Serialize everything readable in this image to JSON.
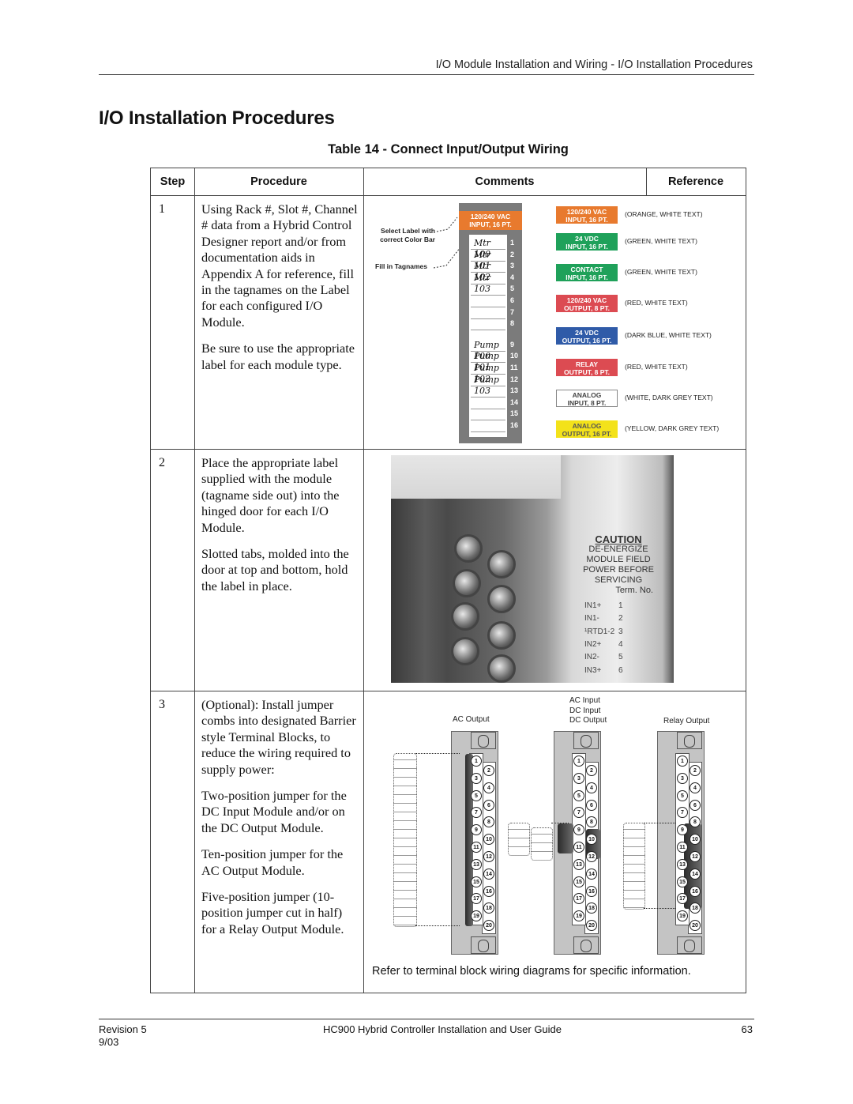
{
  "header": {
    "running_head": "I/O Module Installation and Wiring - I/O Installation Procedures"
  },
  "page_title": "I/O Installation Procedures",
  "table": {
    "caption": "Table 14 - Connect Input/Output Wiring",
    "columns": [
      "Step",
      "Procedure",
      "Comments",
      "Reference"
    ],
    "rows": [
      {
        "step": "1",
        "procedure": [
          "Using Rack #, Slot #, Channel # data from a Hybrid Control Designer report and/or from documentation aids in Appendix A for reference, fill in the tagnames on the Label for each configured I/O Module.",
          "Be sure to use the appropriate label for each module type."
        ],
        "figure": {
          "callouts": [
            "Select Label with correct Color Bar",
            "Fill in Tagnames"
          ],
          "sample_label": {
            "bar_text": [
              "120/240  VAC",
              "INPUT, 16 PT."
            ],
            "bar_color": "#e87a2e",
            "tagnames": [
              "Mtr 100",
              "Mtr 101",
              "Mtr 102",
              "Mtr 103",
              "",
              "",
              "",
              "",
              "Pump 100",
              "Pump 101",
              "Pump 102",
              "Pump 103",
              "",
              "",
              "",
              ""
            ],
            "channels": [
              "1",
              "2",
              "3",
              "4",
              "5",
              "6",
              "7",
              "8",
              "9",
              "10",
              "11",
              "12",
              "13",
              "14",
              "15",
              "16"
            ]
          },
          "label_types": [
            {
              "line1": "120/240  VAC",
              "line2": "INPUT, 16 PT.",
              "desc": "(ORANGE, WHITE TEXT)",
              "bg": "#e87a2e",
              "fg": "#ffffff"
            },
            {
              "line1": "24   VDC",
              "line2": "INPUT, 16 PT.",
              "desc": "(GREEN, WHITE TEXT)",
              "bg": "#1fa15a",
              "fg": "#ffffff"
            },
            {
              "line1": "CONTACT",
              "line2": "INPUT, 16 PT.",
              "desc": "(GREEN, WHITE TEXT)",
              "bg": "#1fa15a",
              "fg": "#ffffff"
            },
            {
              "line1": "120/240  VAC",
              "line2": "OUTPUT, 8 PT.",
              "desc": "(RED, WHITE TEXT)",
              "bg": "#dc4b52",
              "fg": "#ffffff"
            },
            {
              "line1": "24  VDC",
              "line2": "OUTPUT, 16 PT.",
              "desc": "(DARK BLUE, WHITE TEXT)",
              "bg": "#2f5ba8",
              "fg": "#ffffff"
            },
            {
              "line1": "RELAY",
              "line2": "OUTPUT, 8 PT.",
              "desc": "(RED, WHITE TEXT)",
              "bg": "#dc4b52",
              "fg": "#ffffff"
            },
            {
              "line1": "ANALOG",
              "line2": "INPUT, 8 PT.",
              "desc": "(WHITE, DARK GREY TEXT)",
              "bg": "#ffffff",
              "fg": "#444444"
            },
            {
              "line1": "ANALOG",
              "line2": "OUTPUT, 16 PT.",
              "desc": "(YELLOW, DARK GREY TEXT)",
              "bg": "#f3e21a",
              "fg": "#555555"
            }
          ]
        }
      },
      {
        "step": "2",
        "procedure": [
          "Place the appropriate label supplied with the module (tagname side out) into the hinged door for each I/O Module.",
          "Slotted tabs, molded into the door at top and bottom, hold the label in place."
        ],
        "photo": {
          "caution_title": "CAUTION",
          "caution_lines": [
            "DE-ENERGIZE",
            "MODULE FIELD",
            "POWER BEFORE",
            "SERVICING"
          ],
          "term_header": "Term. No.",
          "terms": [
            {
              "name": "IN1+",
              "no": "1"
            },
            {
              "name": "IN1-",
              "no": "2"
            },
            {
              "name": "¹RTD1-2",
              "no": "3"
            },
            {
              "name": "IN2+",
              "no": "4"
            },
            {
              "name": "IN2-",
              "no": "5"
            },
            {
              "name": "IN3+",
              "no": "6"
            }
          ]
        }
      },
      {
        "step": "3",
        "procedure": [
          "(Optional): Install jumper combs into designated Barrier style Terminal Blocks, to reduce the wiring required to supply power:",
          "Two-position jumper for the DC Input Module and/or on the DC Output Module.",
          "Ten-position jumper for the AC Output Module.",
          "Five-position jumper (10-position jumper cut in half) for a Relay Output Module."
        ],
        "diagram": {
          "modules": [
            {
              "label": [
                "AC Output"
              ]
            },
            {
              "label": [
                "AC Input",
                "DC Input",
                "DC Output"
              ]
            },
            {
              "label": [
                "Relay Output"
              ]
            }
          ],
          "terminals_odd": [
            "1",
            "3",
            "5",
            "7",
            "9",
            "11",
            "13",
            "15",
            "17",
            "19"
          ],
          "terminals_even": [
            "2",
            "4",
            "6",
            "8",
            "10",
            "12",
            "14",
            "16",
            "18",
            "20"
          ],
          "note": "Refer to terminal block wiring diagrams for specific information."
        }
      }
    ]
  },
  "footer": {
    "revision": "Revision 5",
    "date": "9/03",
    "doc_title": "HC900 Hybrid Controller Installation and User Guide",
    "page_number": "63"
  }
}
